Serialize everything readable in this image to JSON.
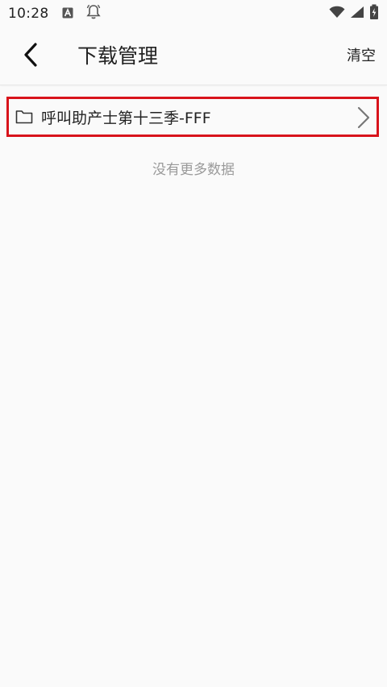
{
  "status_bar": {
    "time": "10:28",
    "icons": [
      "a-box-icon",
      "bell-icon",
      "wifi-icon",
      "signal-icon",
      "battery-charging-icon"
    ]
  },
  "app_bar": {
    "back_icon": "chevron-left-icon",
    "title": "下载管理",
    "clear_label": "清空"
  },
  "downloads": {
    "items": [
      {
        "icon": "folder-icon",
        "name": "呼叫助产士第十三季-FFF",
        "chevron": "chevron-right-icon"
      }
    ],
    "empty_message": "没有更多数据"
  },
  "colors": {
    "highlight_border": "#d8131b",
    "background": "#fafafa",
    "muted_text": "#9a9a9a"
  }
}
